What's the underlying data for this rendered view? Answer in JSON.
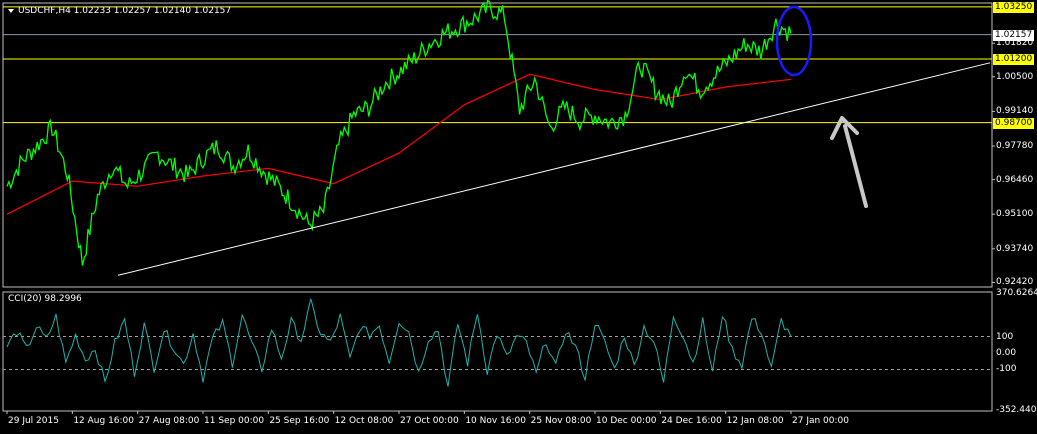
{
  "header": {
    "symbol_line": "USDCHF,H4  1.02233 1.02257 1.02140 1.02157",
    "menu_icon": "triangle-down-icon"
  },
  "indicator": {
    "label": "CCI(20) 98.2996",
    "scale_labels": [
      "370.6264",
      "100",
      "0.00",
      "-100",
      "-352.4404"
    ]
  },
  "colors": {
    "background": "#000000",
    "price_line": "#00ff00",
    "moving_average": "#ff0000",
    "horizontal_level": "#ffff00",
    "cci_line": "#20b2aa",
    "trendline": "#ffffff",
    "annotation_circle": "#1a1aff",
    "annotation_arrow": "#c8c8c8",
    "grid_frame": "#c0c0c0"
  },
  "chart_data": [
    {
      "type": "line",
      "title": "USDCHF,H4",
      "ylim": [
        0.9224,
        1.034
      ],
      "price_scale_labels": [
        "1.03250",
        "1.02157",
        "1.01820",
        "1.01200",
        "1.00500",
        "0.99140",
        "0.98700",
        "0.97780",
        "0.96460",
        "0.95100",
        "0.93740",
        "0.92420"
      ],
      "current_price": "1.02157",
      "horizontal_levels": [
        {
          "label": "1.03250",
          "value": 1.0325
        },
        {
          "label": "1.01200",
          "value": 1.012
        },
        {
          "label": "0.98700",
          "value": 0.987
        }
      ],
      "x_tick_labels": [
        "29 Jul 2015",
        "12 Aug 16:00",
        "27 Aug 08:00",
        "11 Sep 00:00",
        "25 Sep 16:00",
        "12 Oct 08:00",
        "27 Oct 00:00",
        "10 Nov 16:00",
        "25 Nov 08:00",
        "10 Dec 00:00",
        "24 Dec 16:00",
        "12 Jan 08:00",
        "27 Jan 00:00"
      ],
      "series": [
        {
          "key": "price",
          "x": [
            "29 Jul 2015",
            "03 Aug",
            "05 Aug",
            "10 Aug",
            "12 Aug 16:00",
            "17 Aug",
            "21 Aug",
            "24 Aug",
            "27 Aug 08:00",
            "01 Sep",
            "03 Sep",
            "07 Sep",
            "11 Sep 00:00",
            "15 Sep",
            "18 Sep",
            "22 Sep",
            "25 Sep 16:00",
            "30 Sep",
            "02 Oct",
            "07 Oct",
            "12 Oct 08:00",
            "15 Oct",
            "20 Oct",
            "23 Oct",
            "27 Oct 00:00",
            "30 Oct",
            "04 Nov",
            "07 Nov",
            "10 Nov 16:00",
            "13 Nov",
            "18 Nov",
            "21 Nov",
            "24 Nov",
            "25 Nov 08:00",
            "30 Nov",
            "04 Dec",
            "07 Dec",
            "10 Dec 00:00",
            "15 Dec",
            "18 Dec",
            "21 Dec",
            "24 Dec 16:00",
            "29 Dec",
            "01 Jan",
            "05 Jan",
            "08 Jan",
            "12 Jan 08:00",
            "16 Jan",
            "19 Jan",
            "22 Jan",
            "25 Jan",
            "27 Jan 00:00",
            "28 Jan"
          ],
          "values": [
            0.962,
            0.972,
            0.978,
            0.985,
            0.967,
            0.932,
            0.958,
            0.97,
            0.962,
            0.968,
            0.975,
            0.97,
            0.966,
            0.973,
            0.978,
            0.97,
            0.976,
            0.968,
            0.962,
            0.955,
            0.947,
            0.952,
            0.978,
            0.99,
            0.993,
            1.002,
            1.007,
            1.012,
            1.018,
            1.022,
            1.025,
            1.028,
            1.032,
            1.029,
            0.992,
            1.004,
            0.985,
            0.993,
            0.988,
            0.99,
            0.987,
            0.99,
            1.01,
            1.0,
            0.994,
            1.008,
            1.0,
            1.006,
            1.012,
            1.018,
            1.015,
            1.026,
            1.022
          ]
        },
        {
          "key": "ma",
          "x": [
            "29 Jul 2015",
            "12 Aug 16:00",
            "27 Aug 08:00",
            "11 Sep 00:00",
            "25 Sep 16:00",
            "12 Oct 08:00",
            "27 Oct 00:00",
            "10 Nov 16:00",
            "25 Nov 08:00",
            "10 Dec 00:00",
            "24 Dec 16:00",
            "12 Jan 08:00",
            "27 Jan 00:00"
          ],
          "values": [
            0.951,
            0.964,
            0.962,
            0.966,
            0.969,
            0.963,
            0.975,
            0.994,
            1.006,
            1.0,
            0.996,
            1.001,
            1.004
          ]
        }
      ],
      "trendline": {
        "from": {
          "x": "14 Aug",
          "y": 0.927
        },
        "to": {
          "x": "14 Feb",
          "y": 1.0105
        }
      },
      "annotations": [
        {
          "kind": "circle",
          "around": "28 Jan"
        },
        {
          "kind": "arrow",
          "pointing_to": "trendline"
        }
      ]
    },
    {
      "type": "line",
      "title": "CCI(20) 98.2996",
      "ylim": [
        -352.4404,
        370.6264
      ],
      "levels": [
        100,
        -100
      ],
      "series": [
        {
          "name": "CCI(20)",
          "values": [
            40,
            130,
            20,
            160,
            80,
            220,
            -60,
            110,
            -40,
            30,
            -180,
            60,
            200,
            -120,
            170,
            -90,
            140,
            40,
            -70,
            120,
            -150,
            90,
            180,
            -60,
            230,
            50,
            -100,
            150,
            -30,
            190,
            80,
            300,
            120,
            60,
            220,
            -40,
            160,
            110,
            170,
            -50,
            200,
            130,
            -120,
            90,
            140,
            -210,
            180,
            -60,
            250,
            -110,
            120,
            -30,
            100,
            60,
            -130,
            80,
            -90,
            140,
            40,
            -150,
            190,
            60,
            -100,
            110,
            -80,
            160,
            70,
            -180,
            230,
            110,
            -60,
            190,
            -120,
            240,
            20,
            -70,
            210,
            130,
            -100,
            200,
            98
          ]
        }
      ]
    }
  ]
}
